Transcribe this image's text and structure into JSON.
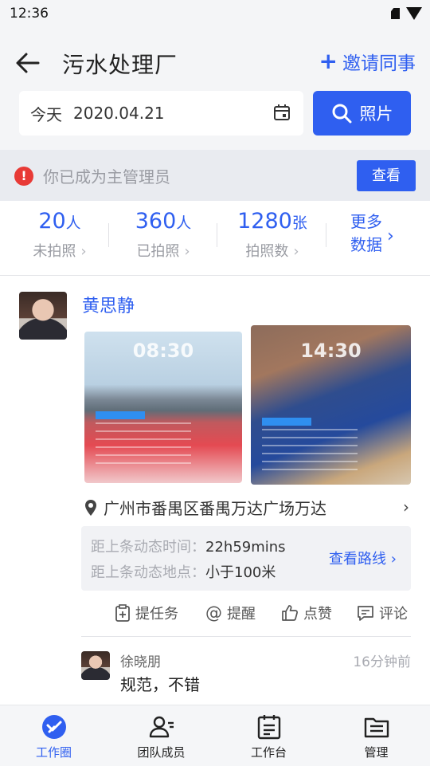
{
  "status_bar": {
    "time": "12:36"
  },
  "header": {
    "title": "污水处理厂",
    "invite_label": "邀请同事",
    "date_prefix": "今天",
    "date_value": "2020.04.21",
    "photo_button": "照片"
  },
  "notice": {
    "text": "你已成为主管理员",
    "button": "查看"
  },
  "stats": [
    {
      "value": "20",
      "unit": "人",
      "label": "未拍照"
    },
    {
      "value": "360",
      "unit": "人",
      "label": "已拍照"
    },
    {
      "value": "1280",
      "unit": "张",
      "label": "拍照数"
    }
  ],
  "more_data": {
    "line1": "更多",
    "line2": "数据"
  },
  "post": {
    "author": "黄思静",
    "photos": [
      {
        "time": "08:30"
      },
      {
        "time": "14:30"
      }
    ],
    "location": "广州市番禺区番禺万达广场万达",
    "route": {
      "time_label": "距上条动态时间：",
      "time_value": "22h59mins",
      "place_label": "距上条动态地点：",
      "place_value": "小于100米",
      "link": "查看路线"
    },
    "actions": {
      "task": "提任务",
      "remind": "提醒",
      "like": "点赞",
      "comment": "评论"
    },
    "comment": {
      "author": "徐晓朋",
      "time": "16分钟前",
      "text": "规范，不错"
    }
  },
  "tabs": [
    {
      "label": "工作圈",
      "icon": "work-circle-icon",
      "active": true
    },
    {
      "label": "团队成员",
      "icon": "team-members-icon",
      "active": false
    },
    {
      "label": "工作台",
      "icon": "workbench-icon",
      "active": false
    },
    {
      "label": "管理",
      "icon": "manage-icon",
      "active": false
    }
  ],
  "colors": {
    "accent": "#2f5ff0",
    "alert": "#e83a36"
  }
}
